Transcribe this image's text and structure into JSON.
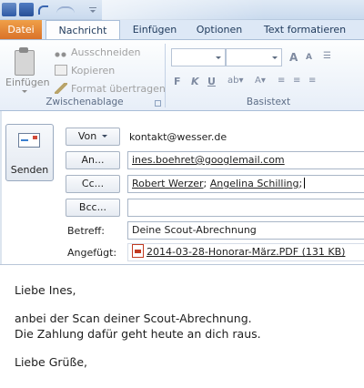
{
  "ribbon": {
    "tabs": [
      "Datei",
      "Nachricht",
      "Einfügen",
      "Optionen",
      "Text formatieren"
    ],
    "clipboard": {
      "paste_label": "Einfügen",
      "cut_label": "Ausschneiden",
      "copy_label": "Kopieren",
      "format_painter_label": "Format übertragen",
      "group_label": "Zwischenablage"
    },
    "basic_text": {
      "group_label": "Basistext",
      "grow_font": "A",
      "shrink_font": "A",
      "bold": "F",
      "italic": "K",
      "underline": "U"
    }
  },
  "compose": {
    "send_label": "Senden",
    "from_button": "Von",
    "from_address": "kontakt@wesser.de",
    "to_button": "An...",
    "to_recipients": [
      "ines.boehret@googlemail.com"
    ],
    "cc_button": "Cc...",
    "cc_recipients": [
      "Robert Werzer",
      "Angelina Schilling"
    ],
    "bcc_button": "Bcc...",
    "subject_label": "Betreff:",
    "subject_value": "Deine Scout-Abrechnung",
    "attached_label": "Angefügt:",
    "attachment": "2014-03-28-Honorar-März.PDF (131 KB)"
  },
  "message_body": {
    "greeting": "Liebe Ines,",
    "line1": "anbei der Scan deiner Scout-Abrechnung.",
    "line2": "Die Zahlung dafür geht heute an dich raus.",
    "closing": "Liebe Grüße,"
  }
}
